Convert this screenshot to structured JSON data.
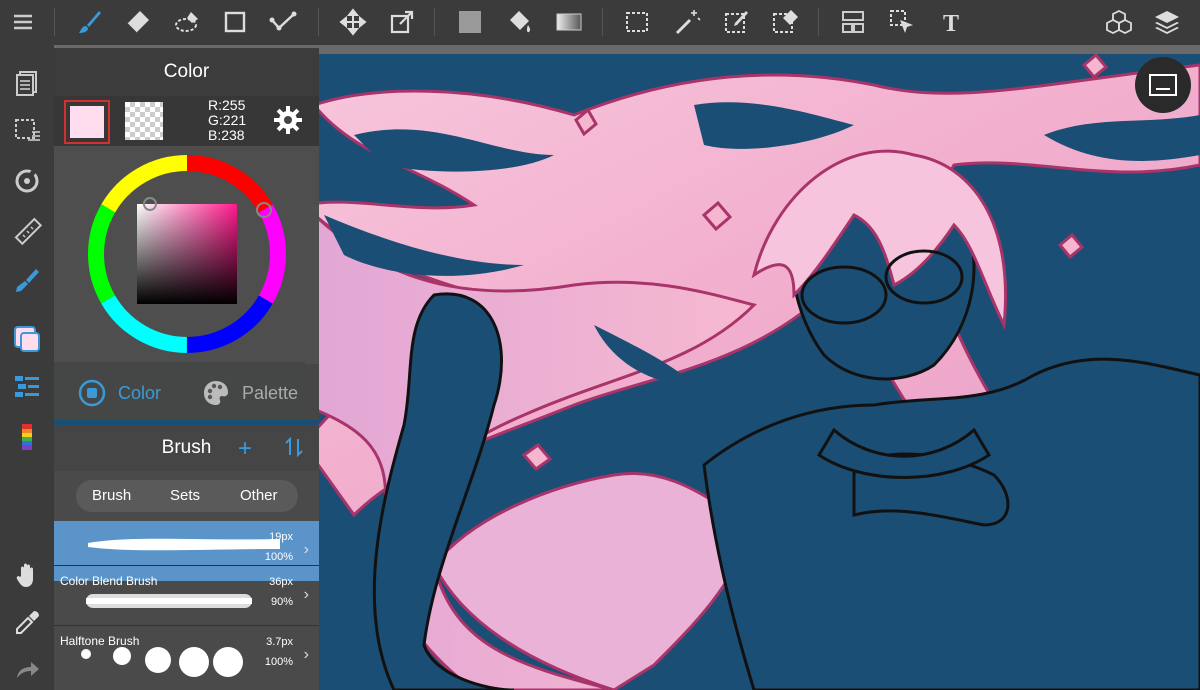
{
  "toolbar": {
    "tools": [
      "menu",
      "brush",
      "eraser",
      "blur",
      "shape",
      "pen-guide",
      "move",
      "transform",
      "fill-color",
      "bucket",
      "gradient",
      "select",
      "magic-wand",
      "select-pen",
      "select-eraser",
      "layer-select",
      "object-select",
      "text",
      "3d",
      "layers"
    ]
  },
  "color_panel": {
    "title": "Color",
    "rgb": {
      "r": "R:255",
      "g": "G:221",
      "b": "B:238"
    },
    "foreground": "#ffddee",
    "tabs": {
      "color": "Color",
      "palette": "Palette"
    }
  },
  "brush_panel": {
    "title": "Brush",
    "segments": [
      "Brush",
      "Sets",
      "Other"
    ],
    "items": [
      {
        "name": "",
        "size": "19px",
        "opacity": "100%"
      },
      {
        "name": "Color Blend Brush",
        "size": "36px",
        "opacity": "90%"
      },
      {
        "name": "Halftone Brush",
        "size": "3.7px",
        "opacity": "100%"
      }
    ]
  },
  "colors": {
    "accent": "#3a9ad9",
    "canvas": "#1b4e74",
    "hair": "#f4b8d0"
  }
}
